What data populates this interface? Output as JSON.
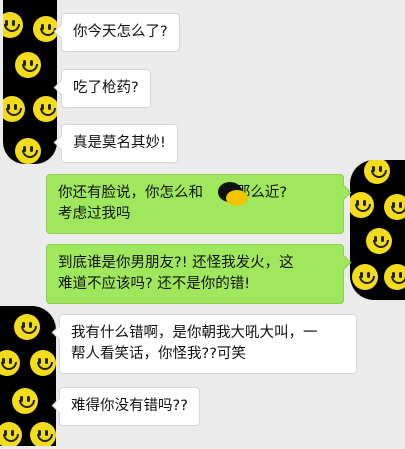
{
  "messages": [
    {
      "side": "left",
      "text": "你今天怎么了?"
    },
    {
      "side": "left",
      "text": "吃了枪药?"
    },
    {
      "side": "left",
      "text": "真是莫名其妙!"
    },
    {
      "side": "right",
      "lines": [
        "你还有脸说，你怎么和    走那么近?",
        "考虑过我吗"
      ]
    },
    {
      "side": "right",
      "lines": [
        "到底谁是你男朋友?! 还怪我发火，这",
        "难道不应该吗? 还不是你的错!"
      ]
    },
    {
      "side": "left",
      "lines": [
        "我有什么错啊，是你朝我大吼大叫，一",
        "帮人看笑话，你怪我??可笑"
      ]
    },
    {
      "side": "left",
      "text": "难得你没有错吗??"
    }
  ],
  "avatars": [
    {
      "name": "contact-avatar",
      "icon": "smiley-face-icon",
      "colors": {
        "bg": "#000000",
        "face": "#f3dc1c"
      }
    },
    {
      "name": "self-avatar",
      "icon": "smiley-face-icon",
      "colors": {
        "bg": "#000000",
        "face": "#f3dc1c"
      }
    },
    {
      "name": "contact-avatar",
      "icon": "smiley-face-icon",
      "colors": {
        "bg": "#000000",
        "face": "#f3dc1c"
      }
    }
  ],
  "colors": {
    "background": "#ebebeb",
    "bubble_left": "#ffffff",
    "bubble_right": "#9fe75c"
  }
}
